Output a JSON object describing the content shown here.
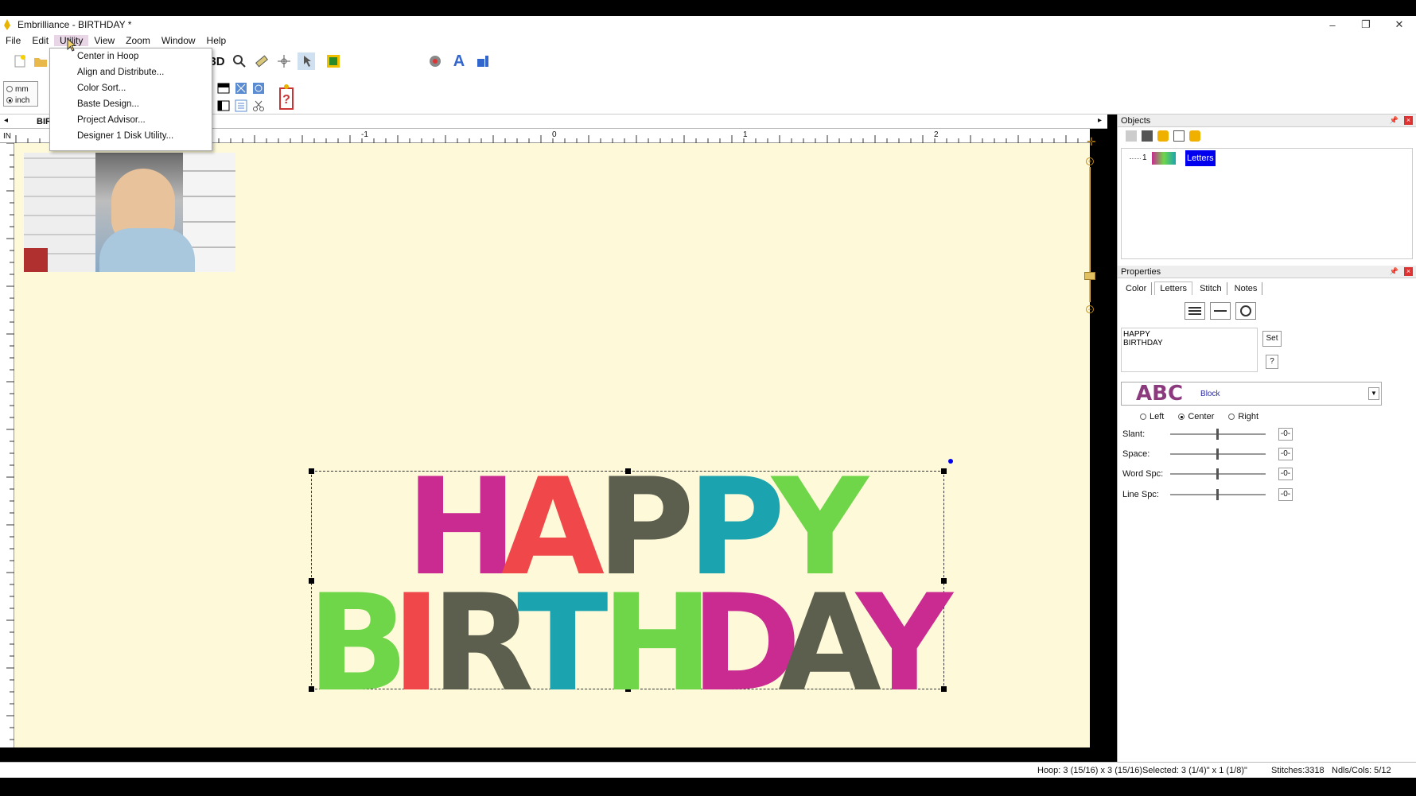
{
  "window": {
    "title": "Embrilliance - BIRTHDAY *",
    "controls": [
      "–",
      "❐",
      "✕"
    ]
  },
  "menu": [
    "File",
    "Edit",
    "Utility",
    "View",
    "Zoom",
    "Window",
    "Help"
  ],
  "utility_menu": [
    "Center in Hoop",
    "Align and Distribute...",
    "Color Sort...",
    "Baste Design...",
    "Project Advisor...",
    "Designer 1 Disk Utility..."
  ],
  "units": {
    "mm": "mm",
    "inch": "inch",
    "selected": "inch"
  },
  "tab_label": "BIR",
  "ruler": {
    "unit": "IN",
    "ticks": [
      "-1",
      "0",
      "1",
      "2"
    ]
  },
  "objects_panel": {
    "title": "Objects",
    "row_number": "1",
    "item_label": "Letters"
  },
  "properties_panel": {
    "title": "Properties",
    "tabs": [
      "Color",
      "Letters",
      "Stitch",
      "Notes"
    ],
    "active_tab": "Letters",
    "text_value": "HAPPY\nBIRTHDAY",
    "set_button": "Set",
    "help_button": "?",
    "font_preview": "ABC",
    "font_name": "Block",
    "alignment": {
      "left": "Left",
      "center": "Center",
      "right": "Right",
      "selected": "Center"
    },
    "sliders": [
      {
        "label": "Slant:",
        "value": "-0-"
      },
      {
        "label": "Space:",
        "value": "-0-"
      },
      {
        "label": "Word Spc:",
        "value": "-0-"
      },
      {
        "label": "Line Spc:",
        "value": "-0-"
      }
    ]
  },
  "design": {
    "line1": [
      {
        "char": "H",
        "color": "#c92b91"
      },
      {
        "char": "A",
        "color": "#f0474a"
      },
      {
        "char": "P",
        "color": "#5c5e4e"
      },
      {
        "char": "P",
        "color": "#1ba4b0"
      },
      {
        "char": "Y",
        "color": "#6fd64a"
      }
    ],
    "line2": [
      {
        "char": "B",
        "color": "#6fd64a"
      },
      {
        "char": "I",
        "color": "#f0474a"
      },
      {
        "char": "R",
        "color": "#5c5e4e"
      },
      {
        "char": "T",
        "color": "#1ba4b0"
      },
      {
        "char": "H",
        "color": "#6fd64a"
      },
      {
        "char": "D",
        "color": "#c92b91"
      },
      {
        "char": "A",
        "color": "#5c5e4e"
      },
      {
        "char": "Y",
        "color": "#c92b91"
      }
    ]
  },
  "status": {
    "hoop": "Hoop: 3 (15/16) x 3 (15/16)",
    "selected": "Selected: 3 (1/4)\" x 1 (1/8)\"",
    "stitches": "Stitches:3318",
    "ndls": "Ndls/Cols: 5/12"
  },
  "colors": {
    "canvas_bg": "#fdf9d9",
    "selection_blue": "#0000ee",
    "menu_highlight": "#e8d5e6"
  }
}
